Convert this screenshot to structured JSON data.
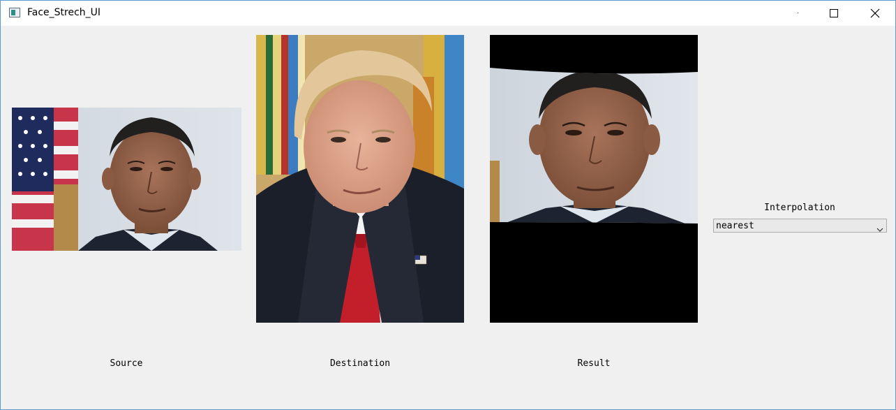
{
  "window": {
    "title": "Face_Strech_UI"
  },
  "labels": {
    "source": "Source",
    "destination": "Destination",
    "result": "Result",
    "interpolation": "Interpolation"
  },
  "interpolation_select": {
    "selected": "nearest"
  },
  "icons": {
    "app": "app-window-icon",
    "minimize": "minimize-icon",
    "maximize": "maximize-icon",
    "close": "close-icon",
    "dropdown": "chevron-down-icon"
  },
  "colors": {
    "window_bg": "#f0f0f0",
    "titlebar_bg": "#ffffff",
    "window_border": "#5b9bd5",
    "result_pad": "#000000"
  }
}
